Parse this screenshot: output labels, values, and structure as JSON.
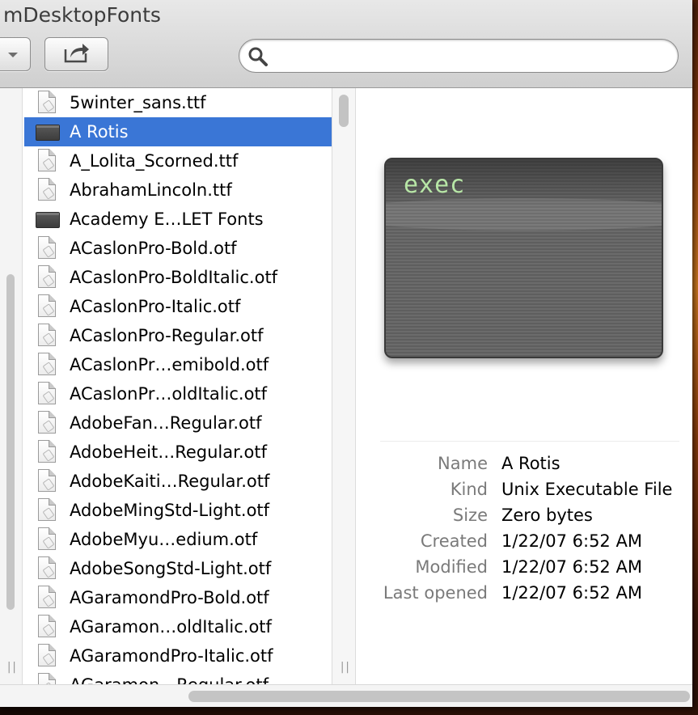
{
  "window": {
    "title": "mDesktopFonts"
  },
  "toolbar": {
    "search": {
      "placeholder": "",
      "value": ""
    }
  },
  "files": [
    {
      "name": "5winter_sans.ttf",
      "icon": "font-document-icon"
    },
    {
      "name": "A Rotis",
      "icon": "unix-executable-icon",
      "selected": true
    },
    {
      "name": "A_Lolita_Scorned.ttf",
      "icon": "font-document-icon"
    },
    {
      "name": "AbrahamLincoln.ttf",
      "icon": "font-document-icon"
    },
    {
      "name": "Academy E…LET Fonts",
      "icon": "unix-executable-icon"
    },
    {
      "name": "ACaslonPro-Bold.otf",
      "icon": "font-document-icon"
    },
    {
      "name": "ACaslonPro-BoldItalic.otf",
      "icon": "font-document-icon"
    },
    {
      "name": "ACaslonPro-Italic.otf",
      "icon": "font-document-icon"
    },
    {
      "name": "ACaslonPro-Regular.otf",
      "icon": "font-document-icon"
    },
    {
      "name": "ACaslonPr…emibold.otf",
      "icon": "font-document-icon"
    },
    {
      "name": "ACaslonPr…oldItalic.otf",
      "icon": "font-document-icon"
    },
    {
      "name": "AdobeFan…Regular.otf",
      "icon": "font-document-icon"
    },
    {
      "name": "AdobeHeit…Regular.otf",
      "icon": "font-document-icon"
    },
    {
      "name": "AdobeKaiti…Regular.otf",
      "icon": "font-document-icon"
    },
    {
      "name": "AdobeMingStd-Light.otf",
      "icon": "font-document-icon"
    },
    {
      "name": "AdobeMyu…edium.otf",
      "icon": "font-document-icon"
    },
    {
      "name": "AdobeSongStd-Light.otf",
      "icon": "font-document-icon"
    },
    {
      "name": "AGaramondPro-Bold.otf",
      "icon": "font-document-icon"
    },
    {
      "name": "AGaramon…oldItalic.otf",
      "icon": "font-document-icon"
    },
    {
      "name": "AGaramondPro-Italic.otf",
      "icon": "font-document-icon"
    },
    {
      "name": "AGaramon…Regular.otf",
      "icon": "font-document-icon"
    }
  ],
  "preview": {
    "icon_label": "exec",
    "info": [
      {
        "key": "Name",
        "value": "A Rotis"
      },
      {
        "key": "Kind",
        "value": "Unix Executable File"
      },
      {
        "key": "Size",
        "value": "Zero bytes"
      },
      {
        "key": "Created",
        "value": "1/22/07 6:52 AM"
      },
      {
        "key": "Modified",
        "value": "1/22/07 6:52 AM"
      },
      {
        "key": "Last opened",
        "value": "1/22/07 6:52 AM"
      }
    ]
  },
  "colors": {
    "selection": "#3a76d6",
    "exec_text": "#b7e6a6"
  }
}
